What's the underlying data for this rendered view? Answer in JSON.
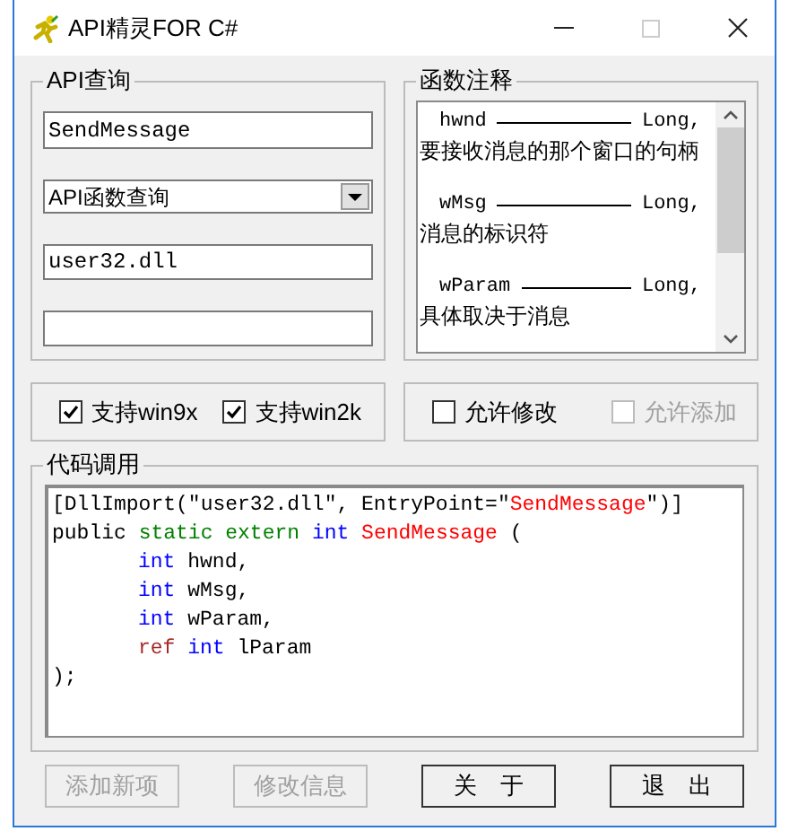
{
  "window": {
    "title": "API精灵FOR C#"
  },
  "query_group": {
    "title": "API查询",
    "name_field": {
      "value": "SendMessage"
    },
    "type_dropdown": {
      "value": "API函数查询"
    },
    "dll_field": {
      "value": "user32.dll"
    }
  },
  "comment_group": {
    "title": "函数注释",
    "params": [
      {
        "name": "hwnd",
        "type": "Long,",
        "description": "要接收消息的那个窗口的句柄"
      },
      {
        "name": "wMsg",
        "type": "Long,",
        "description": "消息的标识符"
      },
      {
        "name": "wParam",
        "type": "Long,",
        "description": "具体取决于消息"
      }
    ]
  },
  "platform_checks": [
    {
      "label": "支持win9x",
      "checked": true,
      "disabled": false
    },
    {
      "label": "支持win2k",
      "checked": true,
      "disabled": false
    }
  ],
  "edit_checks": [
    {
      "label": "允许修改",
      "checked": false,
      "disabled": false
    },
    {
      "label": "允许添加",
      "checked": false,
      "disabled": true
    }
  ],
  "code_group": {
    "title": "代码调用",
    "lines": [
      {
        "indented": false,
        "tokens": [
          {
            "text": "[DllImport(\"user32.dll\", EntryPoint=\"",
            "kind": "plain"
          },
          {
            "text": "SendMessage",
            "kind": "name"
          },
          {
            "text": "\")]",
            "kind": "plain"
          }
        ]
      },
      {
        "indented": false,
        "tokens": [
          {
            "text": "public ",
            "kind": "plain"
          },
          {
            "text": "static extern ",
            "kind": "modifier"
          },
          {
            "text": "int ",
            "kind": "type"
          },
          {
            "text": "SendMessage",
            "kind": "name"
          },
          {
            "text": " (",
            "kind": "plain"
          }
        ]
      },
      {
        "indented": true,
        "tokens": [
          {
            "text": "int ",
            "kind": "type"
          },
          {
            "text": "hwnd,",
            "kind": "plain"
          }
        ]
      },
      {
        "indented": true,
        "tokens": [
          {
            "text": "int ",
            "kind": "type"
          },
          {
            "text": "wMsg,",
            "kind": "plain"
          }
        ]
      },
      {
        "indented": true,
        "tokens": [
          {
            "text": "int ",
            "kind": "type"
          },
          {
            "text": "wParam,",
            "kind": "plain"
          }
        ]
      },
      {
        "indented": true,
        "tokens": [
          {
            "text": "ref ",
            "kind": "ref"
          },
          {
            "text": "int ",
            "kind": "type"
          },
          {
            "text": "lParam",
            "kind": "plain"
          }
        ]
      },
      {
        "indented": false,
        "tokens": [
          {
            "text": ");",
            "kind": "plain"
          }
        ]
      }
    ]
  },
  "buttons": [
    {
      "label": "添加新项",
      "disabled": true
    },
    {
      "label": "修改信息",
      "disabled": true
    },
    {
      "label": "关　于",
      "disabled": false
    },
    {
      "label": "退　出",
      "disabled": false
    }
  ]
}
